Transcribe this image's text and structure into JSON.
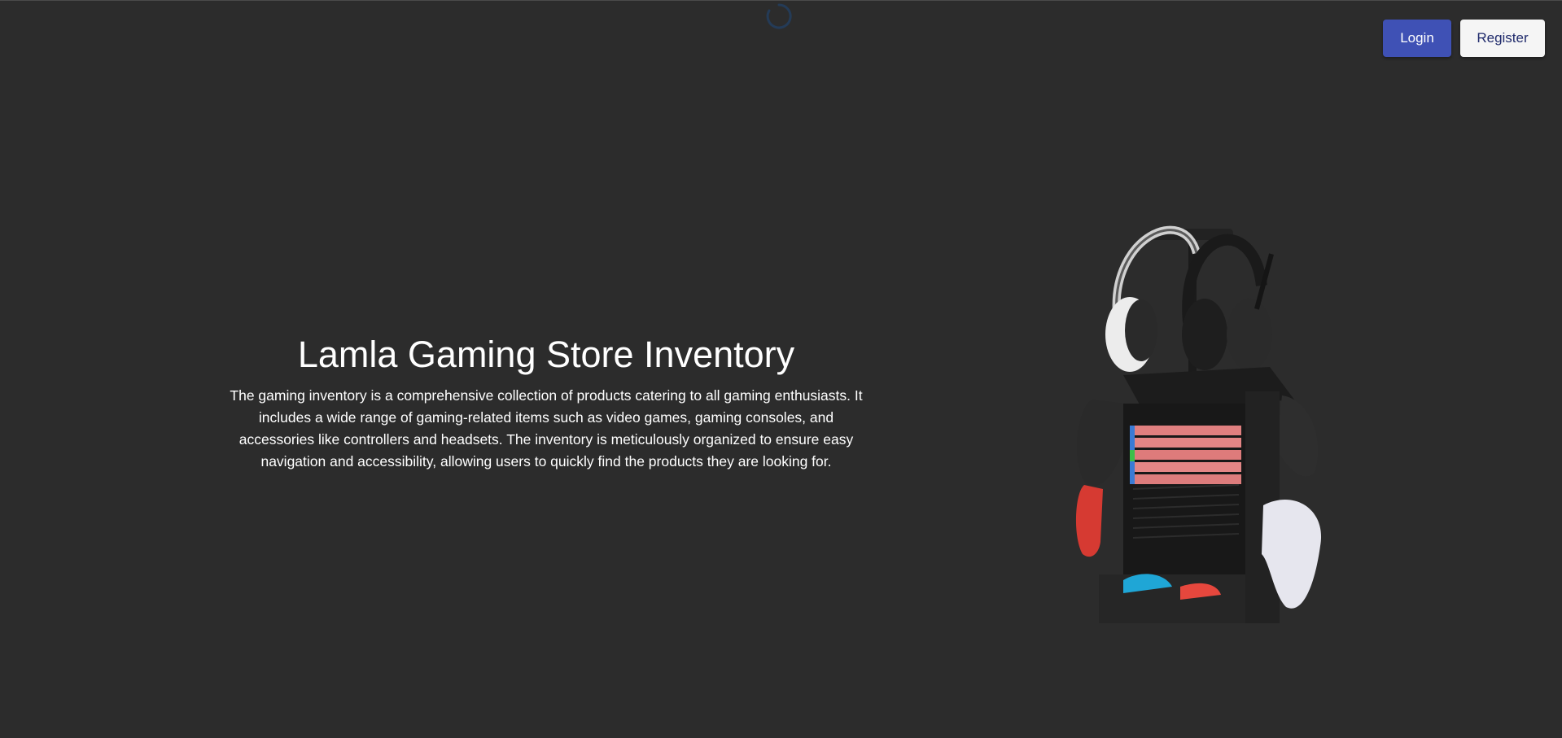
{
  "header": {
    "login_label": "Login",
    "register_label": "Register"
  },
  "hero": {
    "title": "Lamla Gaming Store Inventory",
    "description": "The gaming inventory is a comprehensive collection of products catering to all gaming enthusiasts. It includes a wide range of gaming-related items such as video games, gaming consoles, and accessories like controllers and headsets. The inventory is meticulously organized to ensure easy navigation and accessibility, allowing users to quickly find the products they are looking for.",
    "image_icon": "gaming-storage-tower-image"
  },
  "loader": {
    "icon": "loading-spinner-icon"
  },
  "colors": {
    "background": "#2c2c2c",
    "login_button": "#3f51b5",
    "register_button": "#f5f5f5",
    "text": "#ffffff"
  }
}
